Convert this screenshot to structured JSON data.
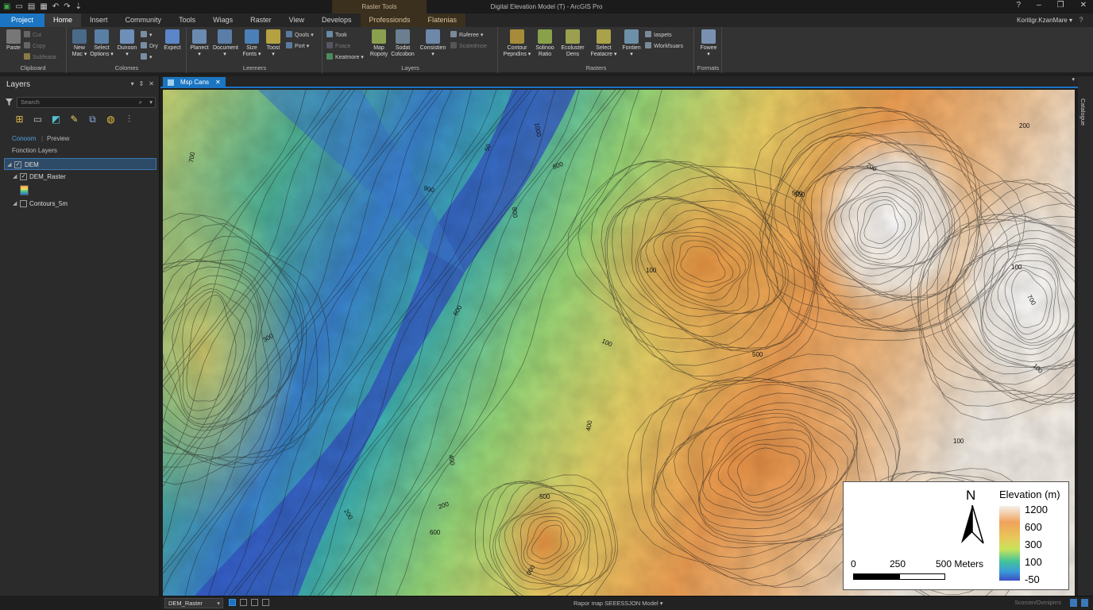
{
  "window": {
    "title": "Digital Elevation Model (T) - ArcGIS Pro",
    "context_tab_title": "Raster Tools",
    "controls": [
      "?",
      "–",
      "❐",
      "✕"
    ]
  },
  "tabs": [
    {
      "label": "Pɾoject"
    },
    {
      "label": "Home"
    },
    {
      "label": "Insert"
    },
    {
      "label": "Community"
    },
    {
      "label": "Tools"
    },
    {
      "label": "Wiags"
    },
    {
      "label": "Raster"
    },
    {
      "label": "View"
    },
    {
      "label": "Develops"
    },
    {
      "label": "Professionds"
    },
    {
      "label": "Flatenias"
    }
  ],
  "account": {
    "name": "Koritigr.KzanMare ▾",
    "help": "?"
  },
  "ribbon": {
    "clipboard": {
      "label": "Clipboard",
      "paste": "Paste",
      "cut": "Cut",
      "copy": "Copy",
      "subtitle": "Subfeatar"
    },
    "colomes": {
      "label": "Colomes",
      "new_map": "New\nMac ▾",
      "select_options": "Select\nOptions ▾",
      "dungeon": "Dunoon\n▾",
      "expect": "Expect"
    },
    "leemers": {
      "label": "Leemers",
      "planect": "Planect\n▾",
      "document": "Document\n▾",
      "size_fonts": "Size\nFonts ▾",
      "tools": "Toost\n▾",
      "goals": "Qools ▾",
      "port": "Port ▾"
    },
    "layers": {
      "label": "Layers",
      "took": "Took",
      "foace": "Foace",
      "keatmore": "Keatmore ▾",
      "map_report": "Map\nRopoty",
      "social_collection": "Sodat\nColcobon",
      "consistien": "Consistien\n▾",
      "reference": "Rəferee ▾",
      "scaledmore": "Scaledmoe"
    },
    "rasters": {
      "label": "Rasters",
      "contour": "Contour\nPepndins ▾",
      "solmoe_ratio": "Solinoo\nRatio",
      "ecoluster_dens": "Ecoluster\nDens",
      "select_feature": "Select\nFeatacre ▾",
      "fontien": "Fontien\n▾",
      "iaspets": "Iaspets",
      "workspaces": "Wlorkfsuars"
    },
    "formats": {
      "label": "Formats",
      "fowee": "Fowee\n▾"
    }
  },
  "layers_panel": {
    "title": "Layers",
    "tools": [
      "▾",
      "⇕",
      "✕"
    ],
    "search_placeholder": "Search",
    "subtab_contents": "Conoom",
    "subtab_preview": "Preview",
    "section_label": "Fonction Layers",
    "items": [
      {
        "label": "DEM",
        "checked": true,
        "selected": true
      },
      {
        "label": "DEM_Raster",
        "checked": true,
        "selected": false
      },
      {
        "label": "Contours_5m",
        "checked": false,
        "selected": false
      }
    ]
  },
  "map_tab": {
    "label": "Msp Cans",
    "close": "✕"
  },
  "right_strip": {
    "label": "Catalogue"
  },
  "map": {
    "contour_labels": [
      "1000",
      "700",
      "50",
      "800",
      "800",
      "900",
      "500",
      "200",
      "500",
      "200",
      "100",
      "100",
      "700",
      "100",
      "500",
      "100",
      "600",
      "300",
      "100",
      "400",
      "400",
      "200",
      "500",
      "200",
      "600",
      "000"
    ]
  },
  "legend": {
    "north": "N",
    "title": "Elevation (m)",
    "ticks": [
      "1200",
      "600",
      "300",
      "100",
      "-50"
    ],
    "scale_labels": [
      "0",
      "250",
      "500 Meters"
    ]
  },
  "status": {
    "layer_select": "DEM_Raster",
    "center": "Rapor map SEEESSJON Model ▾",
    "right": "Scorcen/Ovrniprrrs"
  },
  "colors": {
    "accent": "#1b75c2",
    "context_tab": "#3b2f1e",
    "panel": "#2b2b2b"
  }
}
